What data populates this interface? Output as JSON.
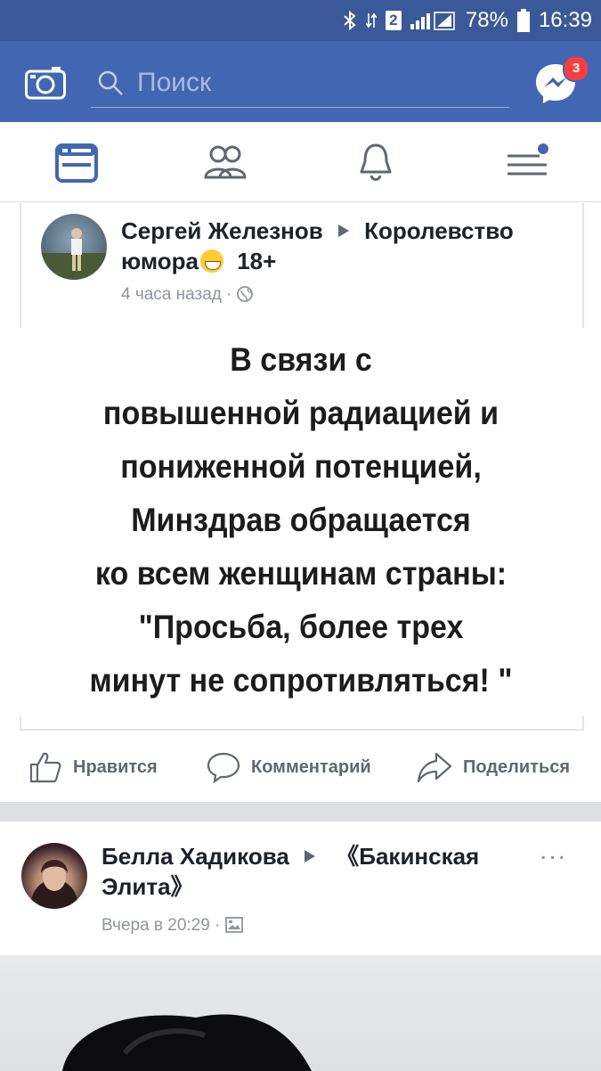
{
  "status_bar": {
    "battery": "78%",
    "time": "16:39",
    "sim_label": "2",
    "icons": [
      "bluetooth-icon",
      "data-arrows-icon",
      "sim-2-icon",
      "signal-icon",
      "battery-icon"
    ]
  },
  "app_bar": {
    "search_placeholder": "Поиск",
    "messenger_badge": "3",
    "icons": [
      "camera-icon",
      "search-icon",
      "messenger-icon"
    ]
  },
  "tabs": [
    {
      "name": "news-feed",
      "icon": "news-feed-icon",
      "active": true
    },
    {
      "name": "friends",
      "icon": "friends-icon",
      "active": false
    },
    {
      "name": "notifications",
      "icon": "bell-icon",
      "active": false
    },
    {
      "name": "menu",
      "icon": "menu-icon",
      "active": false,
      "dot": true
    }
  ],
  "post1": {
    "author": "Сергей Железнов",
    "group": "Королевство юмора",
    "group_suffix": "18+",
    "timestamp": "4 часа назад",
    "privacy_icon": "globe-icon",
    "emoji": "grinning-sweat-emoji",
    "meme_lines": [
      "В связи с",
      "повышенной радиацией и",
      "пониженной потенцией,",
      "Минздрав обращается",
      "ко всем женщинам страны:",
      "\"Просьба, более трех",
      "минут не сопротивляться! \""
    ],
    "actions": {
      "like": "Нравится",
      "comment": "Комментарий",
      "share": "Поделиться"
    }
  },
  "post2": {
    "author": "Белла Хадикова",
    "group": "《Бакинская Элита》",
    "group_line1": "《Бакинская",
    "group_line2": "Элита》",
    "timestamp": "Вчера в 20:29",
    "privacy_icon": "photo-album-icon",
    "more": "..."
  },
  "colors": {
    "fb_blue": "#4267b2",
    "status_bar": "#3b5998",
    "badge": "#fa3e3e",
    "text_dark": "#1d2129",
    "text_muted": "#90949c"
  }
}
